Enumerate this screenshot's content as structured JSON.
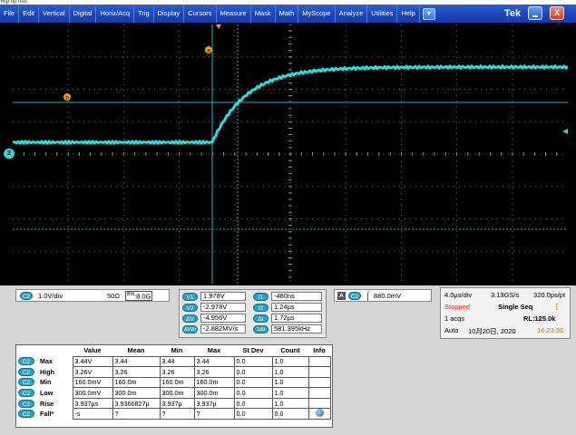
{
  "caption": "Rip rip rise:",
  "menu": {
    "items": [
      "File",
      "Edit",
      "Vertical",
      "Digital",
      "Horiz/Acq",
      "Trig",
      "Display",
      "Cursors",
      "Measure",
      "Mask",
      "Math",
      "MyScope",
      "Analyze",
      "Utilities",
      "Help"
    ],
    "dropdown_icon": "chevron-down-icon",
    "brand": "Tek",
    "close_glyph": "X"
  },
  "waveform": {
    "color": "#20e0e0",
    "channel_marker": "2",
    "cursor_a_label": "a",
    "cursor_b_label": "b",
    "cursor_color": "#f0a000"
  },
  "channel_panel": {
    "channel": "C2",
    "scale": "1.0V/div",
    "impedance": "50Ω",
    "bandwidth_prefix": "BW",
    "bandwidth": ":8.0G"
  },
  "cursor_readout": {
    "v1_label": "V1",
    "v1": "1.978V",
    "v2_label": "V2",
    "v2": "-2.978V",
    "dv_label": "ΔV",
    "dv": "-4.956V",
    "dvdt_label": "ΔV/Δt",
    "dvdt": "-2.882MV/s",
    "t1_label": "t1",
    "t1": "-480ns",
    "t2_label": "t2",
    "t2": "1.24µs",
    "dt_label": "Δt",
    "dt": "1.72µs",
    "inv_dt_label": "1/Δt",
    "inv_dt": "581.395kHz"
  },
  "trigger_panel": {
    "mode_badge": "A",
    "source": "C2",
    "slope_glyph": "⌠",
    "level": "880.0mV"
  },
  "acquisition_panel": {
    "time_div": "4.0µs/div",
    "sample_rate": "3.13GS/s",
    "resolution": "320.0ps/pt",
    "state": "Stopped",
    "mode": "Single Seq",
    "acqs": "1 acqs",
    "record_length": "RL:125.0k",
    "trigger_mode": "Auto",
    "date": "10月20日, 2020",
    "time": "16:23:36",
    "state_color": "#e02020",
    "time_color": "#d08000"
  },
  "measurements": {
    "headers": [
      "Value",
      "Mean",
      "Min",
      "Max",
      "St Dev",
      "Count",
      "Info"
    ],
    "rows": [
      {
        "channel": "C2",
        "name": "Max",
        "value": "3.44V",
        "mean": "3.44",
        "min": "3.44",
        "max": "3.44",
        "stdev": "0.0",
        "count": "1.0"
      },
      {
        "channel": "C2",
        "name": "High",
        "value": "3.26V",
        "mean": "3.26",
        "min": "3.26",
        "max": "3.26",
        "stdev": "0.0",
        "count": "1.0"
      },
      {
        "channel": "C2",
        "name": "Min",
        "value": "160.0mV",
        "mean": "160.0m",
        "min": "160.0m",
        "max": "160.0m",
        "stdev": "0.0",
        "count": "1.0"
      },
      {
        "channel": "C2",
        "name": "Low",
        "value": "300.0mV",
        "mean": "300.0m",
        "min": "300.0m",
        "max": "300.0m",
        "stdev": "0.0",
        "count": "1.0"
      },
      {
        "channel": "C2",
        "name": "Rise",
        "value": "3.937µs",
        "mean": "3.9366827µ",
        "min": "3.937µ",
        "max": "3.937µ",
        "stdev": "0.0",
        "count": "1.0"
      },
      {
        "channel": "C2",
        "name": "Fall*",
        "value": "-s",
        "mean": "?",
        "min": "?",
        "max": "?",
        "stdev": "0.0",
        "count": "0.0"
      }
    ],
    "info_icon": "info-icon"
  }
}
